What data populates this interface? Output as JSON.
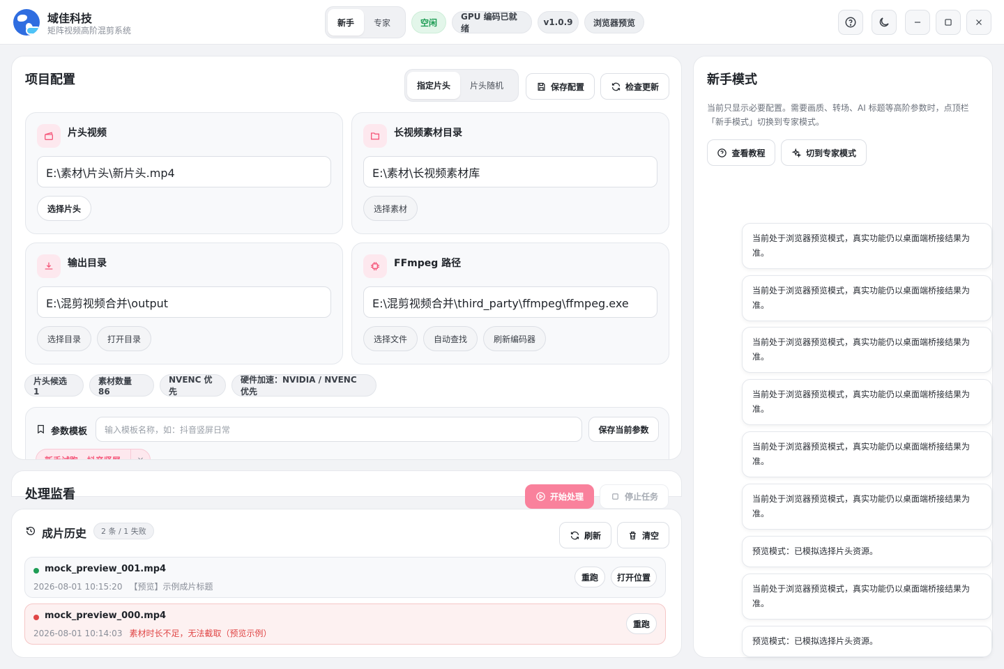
{
  "app": {
    "name": "域佳科技",
    "subtitle": "矩阵视频高阶混剪系统"
  },
  "header": {
    "mode_tabs": [
      "新手",
      "专家"
    ],
    "active_mode": "新手",
    "status_idle": "空闲",
    "gpu_status": "GPU 编码已就绪",
    "version": "v1.0.9",
    "preview_badge": "浏览器预览",
    "icons": [
      "help-icon",
      "theme-icon",
      "minimize-icon",
      "maximize-icon",
      "close-icon"
    ]
  },
  "project": {
    "title": "项目配置",
    "intro_tabs": [
      "指定片头",
      "片头随机"
    ],
    "active_intro_tab": "指定片头",
    "save_label": "保存配置",
    "update_label": "检查更新",
    "intro": {
      "title": "片头视频",
      "path": "E:\\素材\\片头\\新片头.mp4",
      "btn": "选择片头"
    },
    "material": {
      "title": "长视频素材目录",
      "path": "E:\\素材\\长视频素材库",
      "btn": "选择素材"
    },
    "output": {
      "title": "输出目录",
      "path": "E:\\混剪视频合并\\output",
      "btn1": "选择目录",
      "btn2": "打开目录"
    },
    "ffmpeg": {
      "title": "FFmpeg 路径",
      "path": "E:\\混剪视频合并\\third_party\\ffmpeg\\ffmpeg.exe",
      "btn1": "选择文件",
      "btn2": "自动查找",
      "btn3": "刷新编码器"
    },
    "chips": [
      "片头候选 1",
      "素材数量 86",
      "NVENC 优先",
      "硬件加速：NVIDIA / NVENC 优先"
    ],
    "template": {
      "label": "参数模板",
      "placeholder": "输入模板名称，如：抖音竖屏日常",
      "save_btn": "保存当前参数",
      "tag": "新手试跑 · 抖音竖屏",
      "tag_close": "×"
    }
  },
  "monitor": {
    "title": "处理监看",
    "start_btn": "开始处理",
    "stop_btn": "停止任务"
  },
  "history": {
    "title": "成片历史",
    "count_badge": "2 条 / 1 失败",
    "refresh_btn": "刷新",
    "clear_btn": "清空",
    "rows": [
      {
        "name": "mock_preview_001.mp4",
        "time": "2026-08-01 10:15:20",
        "note": "【预览】示例成片标题",
        "status": "ok",
        "btn1": "重跑",
        "btn2": "打开位置"
      },
      {
        "name": "mock_preview_000.mp4",
        "time": "2026-08-01 10:14:03",
        "note": "素材时长不足，无法截取（预览示例）",
        "status": "error",
        "btn1": "重跑"
      }
    ]
  },
  "novice": {
    "title": "新手模式",
    "desc": "当前只显示必要配置。需要画质、转场、AI 标题等高阶参数时，点顶栏「新手模式」切换到专家模式。",
    "tutorial_btn": "查看教程",
    "expert_btn": "切到专家模式"
  },
  "toasts": [
    "当前处于浏览器预览模式，真实功能仍以桌面端桥接结果为准。",
    "当前处于浏览器预览模式，真实功能仍以桌面端桥接结果为准。",
    "当前处于浏览器预览模式，真实功能仍以桌面端桥接结果为准。",
    "当前处于浏览器预览模式，真实功能仍以桌面端桥接结果为准。",
    "当前处于浏览器预览模式，真实功能仍以桌面端桥接结果为准。",
    "当前处于浏览器预览模式，真实功能仍以桌面端桥接结果为准。",
    "预览模式：已模拟选择片头资源。",
    "当前处于浏览器预览模式，真实功能仍以桌面端桥接结果为准。",
    "预览模式：已模拟选择片头资源。"
  ],
  "colors": {
    "accent_pink": "#f5577a",
    "success": "#1e9d55",
    "danger": "#e04545",
    "brand_blue": "#2f6de0"
  }
}
